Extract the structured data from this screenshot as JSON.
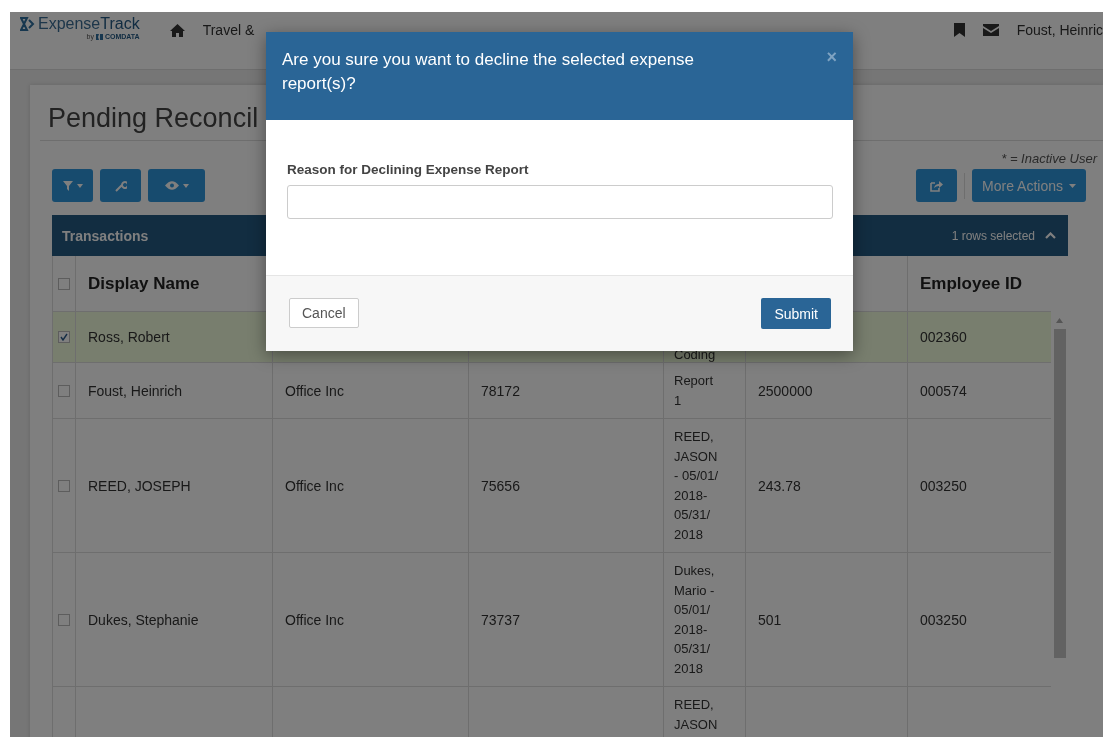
{
  "navbar": {
    "brand": {
      "name_light": "Expense",
      "name_bold": "Track",
      "byline": "by",
      "company": "COMDATA"
    },
    "items": [
      {
        "label": "Travel &"
      }
    ],
    "user": "Foust, Heinric"
  },
  "page": {
    "title": "Pending Reconcil",
    "note": "* = Inactive User",
    "more_actions": "More Actions"
  },
  "table": {
    "title": "Transactions",
    "selection": "1 rows selected",
    "all_checked": false,
    "columns": {
      "display_name": "Display Name",
      "employee_id": "Employee ID"
    },
    "rows": [
      {
        "selected": true,
        "checked": true,
        "display_name": "Ross, Robert",
        "column_4": "Coding",
        "employee_id": "002360"
      },
      {
        "selected": false,
        "checked": false,
        "display_name": "Foust, Heinrich",
        "column_2": "Office Inc",
        "column_3": "78172",
        "column_4": "Report 1",
        "column_5": "2500000",
        "employee_id": "000574"
      },
      {
        "selected": false,
        "checked": false,
        "display_name": "REED, JOSEPH",
        "column_2": "Office Inc",
        "column_3": "75656",
        "column_4": "REED, JASON - 05/01/ 2018- 05/31/ 2018",
        "column_5": "243.78",
        "employee_id": "003250"
      },
      {
        "selected": false,
        "checked": false,
        "display_name": "Dukes, Stephanie",
        "column_2": "Office Inc",
        "column_3": "73737",
        "column_4": "Dukes, Mario - 05/01/ 2018- 05/31/ 2018",
        "column_5": "501",
        "employee_id": "003250"
      },
      {
        "selected": false,
        "column_4": "REED, JASON"
      }
    ]
  },
  "modal": {
    "title": "Are you sure you want to decline the selected expense report(s)?",
    "close": "×",
    "field_label": "Reason for Declining Expense Report",
    "cancel": "Cancel",
    "submit": "Submit"
  }
}
